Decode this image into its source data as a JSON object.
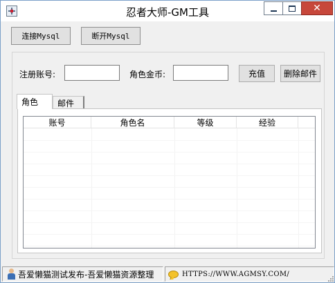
{
  "window": {
    "title": "忍者大师-GM工具",
    "close_glyph": "✕"
  },
  "toolbar": {
    "connect_label": "连接Mysql",
    "disconnect_label": "断开Mysql"
  },
  "form": {
    "account_label": "注册账号:",
    "account_value": "",
    "gold_label": "角色金币:",
    "gold_value": "",
    "recharge_label": "充值",
    "delete_mail_label": "删除邮件"
  },
  "tabs": [
    {
      "label": "角色",
      "selected": true
    },
    {
      "label": "邮件",
      "selected": false
    }
  ],
  "list": {
    "columns": [
      "账号",
      "角色名",
      "等级",
      "经验"
    ],
    "rows": []
  },
  "statusbar": {
    "left_text": "吾爱懒猫测试发布-吾爱懒猫资源整理",
    "left_icon": "person-icon",
    "right_text": "HTTPS://WWW.AGMSY.COM/",
    "right_icon": "chat-icon"
  },
  "colors": {
    "close_button": "#c7473b",
    "window_bg": "#f0f0f0",
    "border_accent": "#7a9fc8"
  }
}
